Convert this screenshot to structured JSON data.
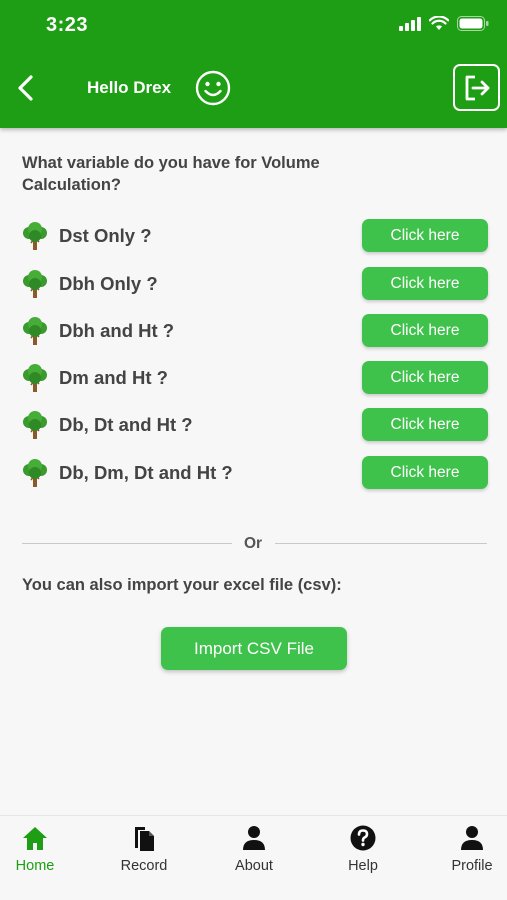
{
  "status_bar": {
    "time": "3:23"
  },
  "header": {
    "greeting": "Hello Drex"
  },
  "main": {
    "question": "What variable do you have for Volume Calculation?",
    "options": [
      {
        "label": "Dst Only ?",
        "button": "Click here"
      },
      {
        "label": "Dbh Only ?",
        "button": "Click here"
      },
      {
        "label": "Dbh and Ht ?",
        "button": "Click here"
      },
      {
        "label": "Dm and Ht ?",
        "button": "Click here"
      },
      {
        "label": "Db, Dt and Ht ?",
        "button": "Click here"
      },
      {
        "label": "Db, Dm, Dt and Ht ?",
        "button": "Click here"
      }
    ],
    "divider_text": "Or",
    "import_label": "You can also import your excel file (csv):",
    "import_button": "Import CSV File"
  },
  "bottom_nav": {
    "items": [
      {
        "label": "Home",
        "icon": "home-icon",
        "active": true
      },
      {
        "label": "Record",
        "icon": "record-icon",
        "active": false
      },
      {
        "label": "About",
        "icon": "person-icon",
        "active": false
      },
      {
        "label": "Help",
        "icon": "help-icon",
        "active": false
      },
      {
        "label": "Profile",
        "icon": "person-icon",
        "active": false
      }
    ]
  },
  "colors": {
    "header": "#1e9e14",
    "button": "#3fc24c",
    "active_nav": "#1e9e14",
    "text": "#444444"
  }
}
